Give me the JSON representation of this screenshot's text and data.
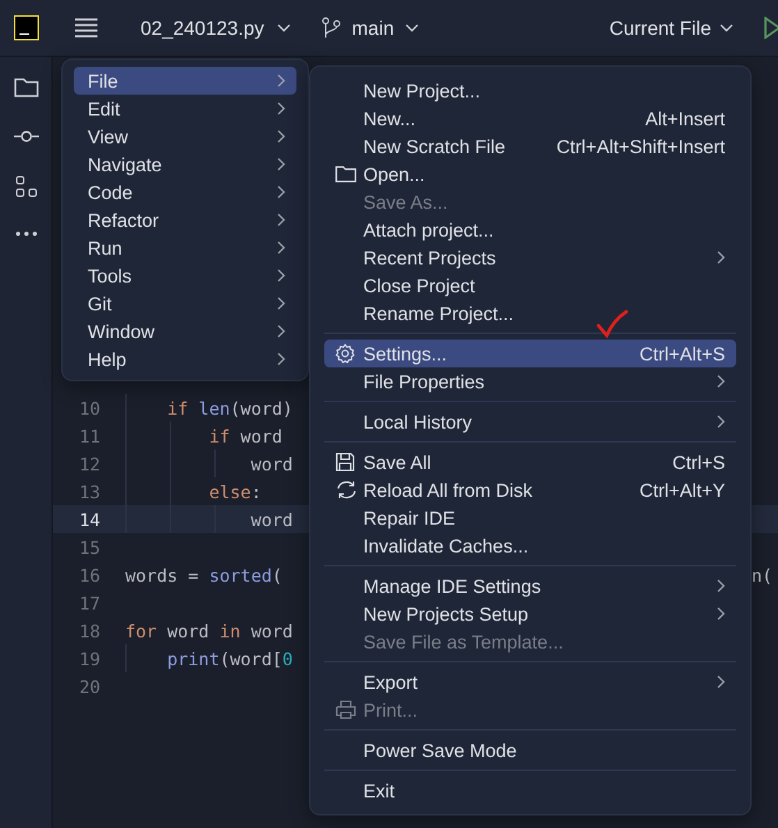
{
  "toolbar": {
    "project": "02_240123.py",
    "branch": "main",
    "run_config": "Current File"
  },
  "editor": {
    "lines": [
      {
        "number": "10",
        "current": false,
        "tokens": [
          {
            "kind": "keyword",
            "text": "    if"
          },
          {
            "kind": "builtin",
            "text": " len"
          },
          {
            "kind": "plain",
            "text": "(word)"
          }
        ]
      },
      {
        "number": "11",
        "current": false,
        "tokens": [
          {
            "kind": "keyword",
            "text": "        if"
          },
          {
            "kind": "plain",
            "text": " word"
          }
        ]
      },
      {
        "number": "12",
        "current": false,
        "tokens": [
          {
            "kind": "plain",
            "text": "            word"
          }
        ]
      },
      {
        "number": "13",
        "current": false,
        "tokens": [
          {
            "kind": "keyword",
            "text": "        else"
          },
          {
            "kind": "plain",
            "text": ":"
          }
        ]
      },
      {
        "number": "14",
        "current": true,
        "tokens": [
          {
            "kind": "plain",
            "text": "            word"
          }
        ]
      },
      {
        "number": "15",
        "current": false
      },
      {
        "number": "16",
        "current": false,
        "tokens": [
          {
            "kind": "plain",
            "text": "words = "
          },
          {
            "kind": "builtin",
            "text": "sorted"
          },
          {
            "kind": "plain",
            "text": "("
          }
        ],
        "right_fragment": "n("
      },
      {
        "number": "17",
        "current": false
      },
      {
        "number": "18",
        "current": false,
        "tokens": [
          {
            "kind": "keyword",
            "text": "for"
          },
          {
            "kind": "plain",
            "text": " word "
          },
          {
            "kind": "keyword",
            "text": "in"
          },
          {
            "kind": "plain",
            "text": " word"
          }
        ]
      },
      {
        "number": "19",
        "current": false,
        "tokens": [
          {
            "kind": "builtin",
            "text": "    print"
          },
          {
            "kind": "plain",
            "text": "(word["
          },
          {
            "kind": "number",
            "text": "0"
          }
        ]
      },
      {
        "number": "20",
        "current": false
      }
    ]
  },
  "main_menu": [
    {
      "label": "File",
      "selected": true
    },
    {
      "label": "Edit",
      "selected": false
    },
    {
      "label": "View",
      "selected": false
    },
    {
      "label": "Navigate",
      "selected": false
    },
    {
      "label": "Code",
      "selected": false
    },
    {
      "label": "Refactor",
      "selected": false
    },
    {
      "label": "Run",
      "selected": false
    },
    {
      "label": "Tools",
      "selected": false
    },
    {
      "label": "Git",
      "selected": false
    },
    {
      "label": "Window",
      "selected": false
    },
    {
      "label": "Help",
      "selected": false
    }
  ],
  "file_menu": [
    {
      "kind": "plain",
      "label": "New Project...",
      "selected": false,
      "disabled": false,
      "submenu": false
    },
    {
      "kind": "plain",
      "label": "New...",
      "shortcut": "Alt+Insert",
      "selected": false,
      "disabled": false,
      "submenu": false
    },
    {
      "kind": "plain",
      "label": "New Scratch File",
      "shortcut": "Ctrl+Alt+Shift+Insert",
      "selected": false,
      "disabled": false,
      "submenu": false
    },
    {
      "kind": "open",
      "label": "Open...",
      "selected": false,
      "disabled": false,
      "submenu": false
    },
    {
      "kind": "plain",
      "label": "Save As...",
      "selected": false,
      "disabled": true,
      "submenu": false
    },
    {
      "kind": "plain",
      "label": "Attach project...",
      "selected": false,
      "disabled": false,
      "submenu": false
    },
    {
      "kind": "plain",
      "label": "Recent Projects",
      "selected": false,
      "disabled": false,
      "submenu": true
    },
    {
      "kind": "plain",
      "label": "Close Project",
      "selected": false,
      "disabled": false,
      "submenu": false
    },
    {
      "kind": "plain",
      "label": "Rename Project...",
      "selected": false,
      "disabled": false,
      "submenu": false
    },
    {
      "kind": "separator"
    },
    {
      "kind": "settings",
      "label": "Settings...",
      "shortcut": "Ctrl+Alt+S",
      "selected": true,
      "disabled": false,
      "submenu": false
    },
    {
      "kind": "plain",
      "label": "File Properties",
      "selected": false,
      "disabled": false,
      "submenu": true
    },
    {
      "kind": "separator"
    },
    {
      "kind": "plain",
      "label": "Local History",
      "selected": false,
      "disabled": false,
      "submenu": true
    },
    {
      "kind": "separator"
    },
    {
      "kind": "save",
      "label": "Save All",
      "shortcut": "Ctrl+S",
      "selected": false,
      "disabled": false,
      "submenu": false
    },
    {
      "kind": "reload",
      "label": "Reload All from Disk",
      "shortcut": "Ctrl+Alt+Y",
      "selected": false,
      "disabled": false,
      "submenu": false
    },
    {
      "kind": "plain",
      "label": "Repair IDE",
      "selected": false,
      "disabled": false,
      "submenu": false
    },
    {
      "kind": "plain",
      "label": "Invalidate Caches...",
      "selected": false,
      "disabled": false,
      "submenu": false
    },
    {
      "kind": "separator"
    },
    {
      "kind": "plain",
      "label": "Manage IDE Settings",
      "selected": false,
      "disabled": false,
      "submenu": true
    },
    {
      "kind": "plain",
      "label": "New Projects Setup",
      "selected": false,
      "disabled": false,
      "submenu": true
    },
    {
      "kind": "plain",
      "label": "Save File as Template...",
      "selected": false,
      "disabled": true,
      "submenu": false
    },
    {
      "kind": "separator"
    },
    {
      "kind": "plain",
      "label": "Export",
      "selected": false,
      "disabled": false,
      "submenu": true
    },
    {
      "kind": "print",
      "label": "Print...",
      "selected": false,
      "disabled": true,
      "submenu": false
    },
    {
      "kind": "separator"
    },
    {
      "kind": "plain",
      "label": "Power Save Mode",
      "selected": false,
      "disabled": false,
      "submenu": false
    },
    {
      "kind": "separator"
    },
    {
      "kind": "plain",
      "label": "Exit",
      "selected": false,
      "disabled": false,
      "submenu": false
    }
  ]
}
